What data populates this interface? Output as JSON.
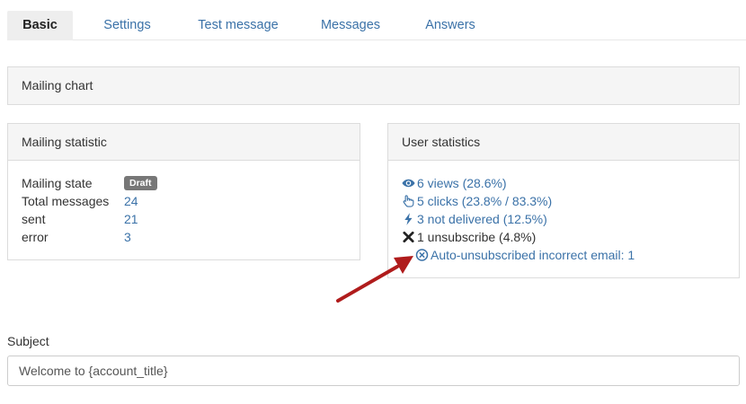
{
  "tabs": [
    {
      "label": "Basic",
      "active": true
    },
    {
      "label": "Settings",
      "active": false
    },
    {
      "label": "Test message",
      "active": false
    },
    {
      "label": "Messages",
      "active": false
    },
    {
      "label": "Answers",
      "active": false
    }
  ],
  "mailing_chart": {
    "title": "Mailing chart"
  },
  "mailing_statistic": {
    "title": "Mailing statistic",
    "state_label": "Mailing state",
    "state_badge": "Draft",
    "rows": [
      {
        "label": "Total messages",
        "value": "24"
      },
      {
        "label": "sent",
        "value": "21"
      },
      {
        "label": "error",
        "value": "3"
      }
    ]
  },
  "user_statistics": {
    "title": "User statistics",
    "views": "6 views (28.6%)",
    "clicks": "5 clicks (23.8% / 83.3%)",
    "not_delivered": "3 not delivered (12.5%)",
    "unsubscribe": "1 unsubscribe (4.8%)",
    "auto_unsubscribed": "Auto-unsubscribed incorrect email: 1"
  },
  "icons": {
    "views": "eye-icon",
    "clicks": "hand-pointer-icon",
    "not_delivered": "bolt-icon",
    "unsubscribe": "x-mark-icon",
    "auto_unsubscribed": "circle-x-icon"
  },
  "annotation": {
    "arrow_color": "#b01c1c"
  },
  "subject": {
    "label": "Subject",
    "value": "Welcome to {account_title}"
  },
  "colors": {
    "link": "#3b72a8",
    "badge": "#777777",
    "panel_header": "#f5f5f5"
  }
}
